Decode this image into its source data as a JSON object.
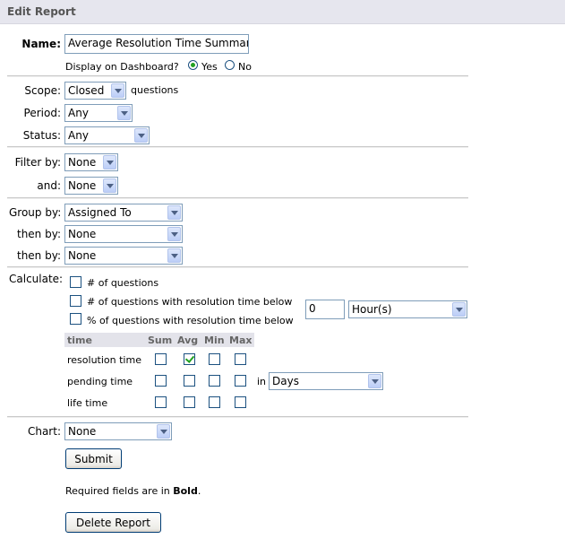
{
  "header": {
    "title": "Edit Report"
  },
  "name": {
    "label": "Name:",
    "value": "Average Resolution Time Summary"
  },
  "dashboard": {
    "label": "Display on Dashboard?",
    "yes": "Yes",
    "no": "No",
    "selected": "Yes"
  },
  "scope": {
    "label": "Scope:",
    "value": "Closed",
    "suffix": "questions"
  },
  "period": {
    "label": "Period:",
    "value": "Any"
  },
  "status": {
    "label": "Status:",
    "value": "Any"
  },
  "filter1": {
    "label": "Filter by:",
    "value": "None"
  },
  "filter2": {
    "label": "and:",
    "value": "None"
  },
  "group1": {
    "label": "Group by:",
    "value": "Assigned To"
  },
  "group2": {
    "label": "then by:",
    "value": "None"
  },
  "group3": {
    "label": "then by:",
    "value": "None"
  },
  "calculate": {
    "label": "Calculate:",
    "options": [
      {
        "label": "# of questions",
        "checked": false
      },
      {
        "label": "# of questions with resolution time below",
        "checked": false
      },
      {
        "label": "% of questions with resolution time below",
        "checked": false
      }
    ],
    "threshold_value": "0",
    "threshold_unit": "Hour(s)"
  },
  "time_table": {
    "headers": [
      "time",
      "Sum",
      "Avg",
      "Min",
      "Max"
    ],
    "rows": [
      {
        "label": "resolution time",
        "checks": [
          false,
          true,
          false,
          false
        ]
      },
      {
        "label": "pending time",
        "checks": [
          false,
          false,
          false,
          false
        ]
      },
      {
        "label": "life time",
        "checks": [
          false,
          false,
          false,
          false
        ]
      }
    ],
    "in_label": "in",
    "unit": "Days"
  },
  "chart": {
    "label": "Chart:",
    "value": "None"
  },
  "buttons": {
    "submit": "Submit",
    "delete": "Delete Report"
  },
  "note": {
    "prefix": "Required fields are in ",
    "bold": "Bold",
    "suffix": "."
  }
}
